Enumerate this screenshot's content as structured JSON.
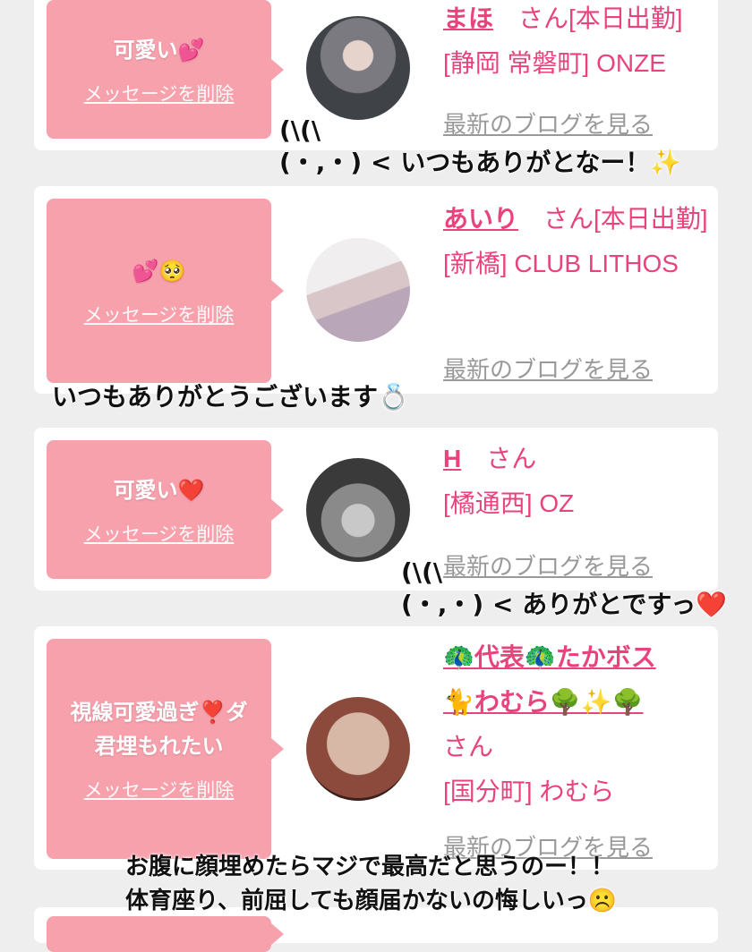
{
  "cards": [
    {
      "message": "可愛い💕",
      "delete_label": "メッセージを削除",
      "name": "まほ",
      "suffix": "さん[本日出勤]",
      "store": "[静岡 常磐町] ONZE",
      "blog_label": "最新のブログを見る"
    },
    {
      "message": "💕🥺",
      "delete_label": "メッセージを削除",
      "name": "あいり",
      "suffix": "さん[本日出勤]",
      "store": "[新橋] CLUB LITHOS",
      "blog_label": "最新のブログを見る"
    },
    {
      "message": "可愛い❤️",
      "delete_label": "メッセージを削除",
      "name": "H",
      "suffix": "さん",
      "store": "[橘通西] OZ",
      "blog_label": "最新のブログを見る"
    },
    {
      "message_line1": "視線可愛過ぎ❣️ダ",
      "message_line2": "君埋もれたい",
      "delete_label": "メッセージを削除",
      "name_line1": "🦚代表🦚たかボス",
      "name_line2": "🐈わむら🌳✨🌳",
      "suffix": "さん",
      "store": "[国分町] わむら",
      "blog_label": "最新のブログを見る"
    }
  ],
  "overlays": {
    "o1_line1": "(\\(\\",
    "o1_line2": "(・,・) < いつもありがとなー！✨",
    "o2": "いつもありがとうございます💍",
    "o3_line1": "(\\(\\",
    "o3_line2": "(・,・) < ありがとですっ❤️",
    "o4_line1": "お腹に顔埋めたらマジで最高だと思うのー！！",
    "o4_line2": "体育座り、前屈しても顔届かないの悔しいっ☹️"
  },
  "colors": {
    "accent": "#e8447b",
    "bubble": "#f7a1ad",
    "background": "#efeeef"
  }
}
